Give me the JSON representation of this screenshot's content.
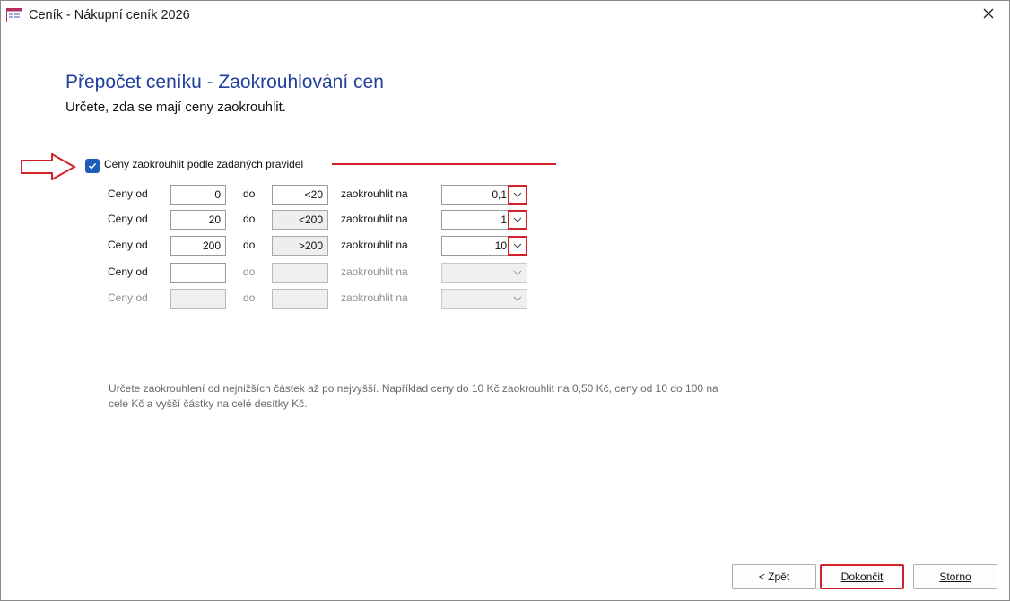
{
  "window": {
    "title": "Ceník - Nákupní ceník 2026"
  },
  "header": {
    "title": "Přepočet ceníku - Zaokrouhlování cen",
    "subtitle": "Určete, zda se mají ceny zaokrouhlit."
  },
  "rounding": {
    "enabled": true,
    "checkbox_label": "Ceny zaokrouhlit podle zadaných pravidel",
    "label_from": "Ceny od",
    "label_to": "do",
    "label_round": "zaokrouhlit na",
    "rows": [
      {
        "from": "0",
        "to": "<20",
        "round": "0,1",
        "enabled": true
      },
      {
        "from": "20",
        "to": "<200",
        "round": "1",
        "enabled": true
      },
      {
        "from": "200",
        "to": ">200",
        "round": "10",
        "enabled": true
      },
      {
        "from": "",
        "to": "",
        "round": "",
        "enabled": false
      },
      {
        "from": "",
        "to": "",
        "round": "",
        "enabled": false
      }
    ]
  },
  "hint": "Určete zaokrouhlení od nejnižších částek až po nejvyšší. Například ceny do 10 Kč zaokrouhlit na 0,50 Kč, ceny od 10 do 100 na cele Kč a vyšší částky na celé desítky Kč.",
  "buttons": {
    "back": "< Zpět",
    "finish": "Dokončit",
    "cancel": "Storno"
  },
  "colors": {
    "heading": "#1f3f9e",
    "annotation": "#d4202a",
    "checkbox": "#1b5db8"
  }
}
